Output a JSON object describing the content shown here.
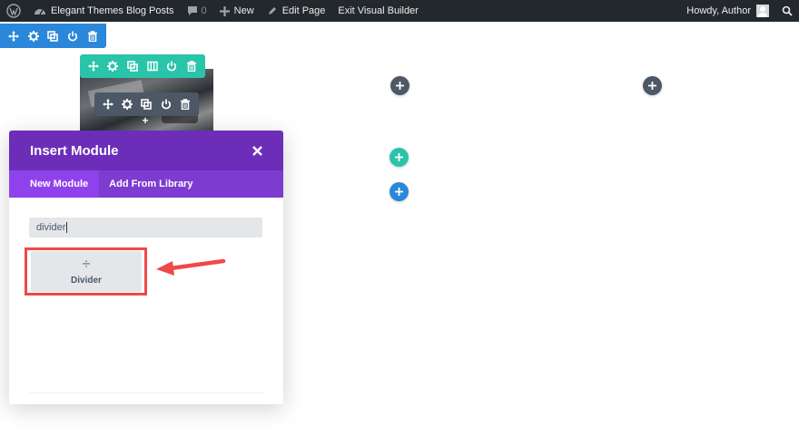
{
  "adminbar": {
    "site_name": "Elegant Themes Blog Posts",
    "comments_count": "0",
    "new_label": "New",
    "edit_label": "Edit Page",
    "exit_label": "Exit Visual Builder",
    "howdy_label": "Howdy, Author"
  },
  "modal": {
    "title": "Insert Module",
    "tabs": [
      {
        "label": "New Module"
      },
      {
        "label": "Add From Library"
      }
    ],
    "search_value": "divider",
    "module_label": "Divider"
  },
  "colors": {
    "section_toolbar": "#2b87da",
    "row_toolbar": "#29c4a9",
    "module_toolbar": "#4c5866",
    "modal_header": "#6c2eb9",
    "modal_tabs": "#7e3bd0",
    "highlight": "#f04848"
  },
  "icons": {
    "toolbar": [
      "move-icon",
      "gear-icon",
      "duplicate-icon",
      "columns-icon",
      "power-icon",
      "trash-icon"
    ],
    "add": "plus-icon",
    "close": "close-icon"
  }
}
